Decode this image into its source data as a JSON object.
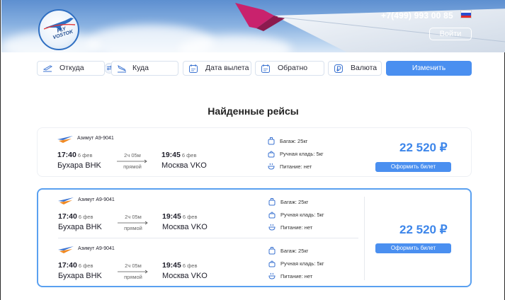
{
  "header": {
    "logo_text": "FLY VOSTOK",
    "phone": "+7(499) 993 00 85",
    "login_label": "Войти",
    "flag_colors": [
      "#ffffff",
      "#2a4dd0",
      "#e12b2b"
    ]
  },
  "search": {
    "from_label": "Откуда",
    "swap_icon": "⇄",
    "to_label": "Куда",
    "depart_label": "Дата вылета",
    "return_label": "Обратно",
    "currency_label": "Валюта",
    "change_label": "Изменить"
  },
  "page_title": "Найденные рейсы",
  "cards": [
    {
      "price": "22 520 ₽",
      "buy_label": "Оформить билет",
      "segments": [
        {
          "airline": "Азимут А9-9041",
          "dep_time": "17:40",
          "dep_date": "6 фев",
          "dep_city": "Бухара BHK",
          "duration": "2ч 05м",
          "direction": "прямой",
          "arr_time": "19:45",
          "arr_date": "6 фев",
          "arr_city": "Москва VKO",
          "baggage": "Багаж: 25кг",
          "hand": "Ручная кладь: 5кг",
          "meal": "Питание: нет"
        }
      ]
    },
    {
      "price": "22 520 ₽",
      "buy_label": "Оформить билет",
      "segments": [
        {
          "airline": "Азимут А9-9041",
          "dep_time": "17:40",
          "dep_date": "6 фев",
          "dep_city": "Бухара BHK",
          "duration": "2ч 05м",
          "direction": "прямой",
          "arr_time": "19:45",
          "arr_date": "6 фев",
          "arr_city": "Москва VKO",
          "baggage": "Багаж: 25кг",
          "hand": "Ручная кладь: 5кг",
          "meal": "Питание: нет"
        },
        {
          "airline": "Азимут А9-9041",
          "dep_time": "17:40",
          "dep_date": "6 фев",
          "dep_city": "Бухара BHK",
          "duration": "2ч 05м",
          "direction": "прямой",
          "arr_time": "19:45",
          "arr_date": "6 фев",
          "arr_city": "Москва VKO",
          "baggage": "Багаж: 25кг",
          "hand": "Ручная кладь: 5кг",
          "meal": "Питание: нет"
        }
      ]
    }
  ],
  "colors": {
    "accent": "#4a8ff0",
    "price": "#3d86ea",
    "selected_border": "#5aa0f0"
  }
}
